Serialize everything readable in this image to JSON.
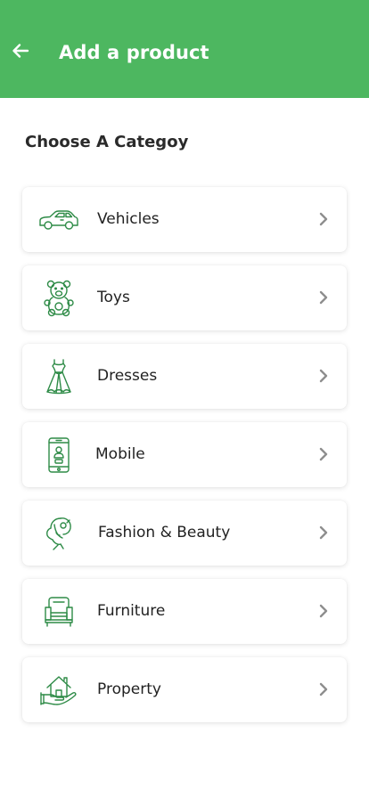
{
  "header": {
    "title": "Add a product",
    "back_icon": "arrow-left-icon",
    "background_color": "#4db760"
  },
  "section": {
    "title": "Choose A Categoy"
  },
  "accent_color": "#2e8b47",
  "categories": [
    {
      "label": "Vehicles",
      "icon": "car-icon"
    },
    {
      "label": "Toys",
      "icon": "teddy-bear-icon"
    },
    {
      "label": "Dresses",
      "icon": "dress-icon"
    },
    {
      "label": "Mobile",
      "icon": "smartphone-icon"
    },
    {
      "label": "Fashion & Beauty",
      "icon": "woman-face-icon"
    },
    {
      "label": "Furniture",
      "icon": "armchair-icon"
    },
    {
      "label": "Property",
      "icon": "house-in-hand-icon"
    }
  ]
}
